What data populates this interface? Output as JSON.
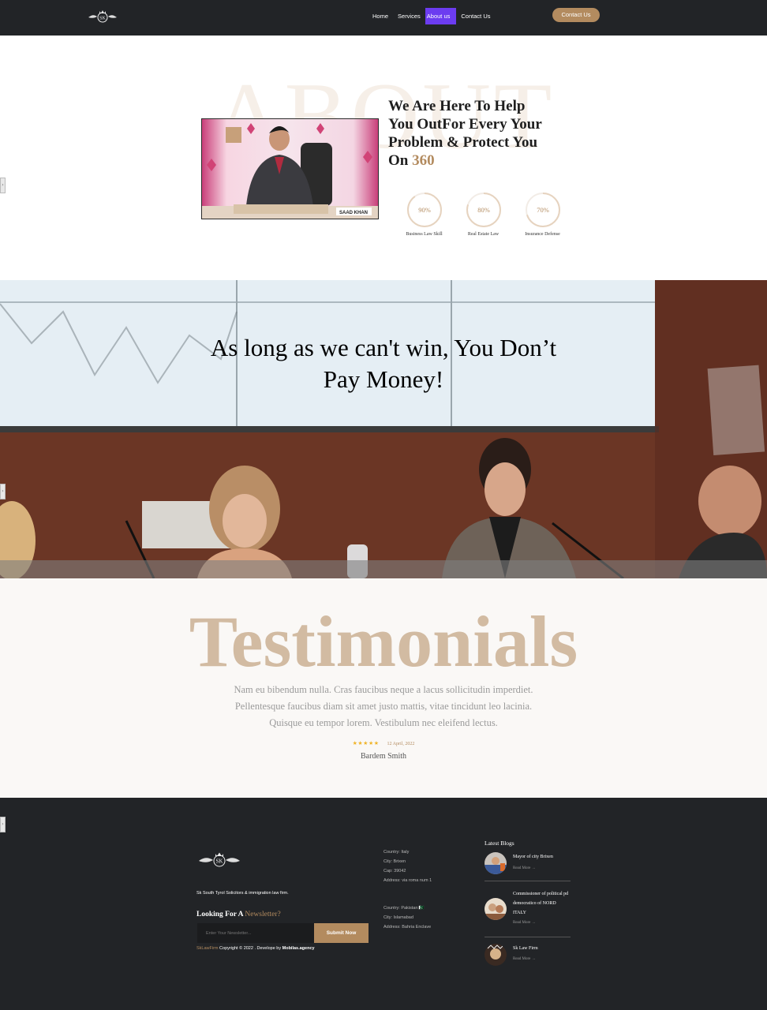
{
  "nav": {
    "links": [
      "Home",
      "Services",
      "About us",
      "Contact Us"
    ],
    "active_index": 2,
    "contact_button": "Contact Us",
    "logo_text": "SK"
  },
  "about": {
    "watermark": "ABOUT",
    "title_main": "We Are Here To Help You OutFor Every Your Problem & Protect You On ",
    "title_accent": "360",
    "photo_caption": "SAAD KHAN",
    "skills": [
      {
        "label": "Business Law Skill",
        "value_text": "90%",
        "value": 90
      },
      {
        "label": "Real Estate Law",
        "value_text": "80%",
        "value": 80
      },
      {
        "label": "Insurance Defense",
        "value_text": "70%",
        "value": 70
      }
    ]
  },
  "banner": {
    "heading_line1": "As long as we can't win, You Don’t",
    "heading_line2": "Pay Money!"
  },
  "testimonials": {
    "title": "Testimonials",
    "text_line1": "Nam eu bibendum nulla. Cras faucibus neque a lacus sollicitudin imperdiet.",
    "text_line2": "Pellentesque faucibus diam sit amet justo mattis, vitae tincidunt leo lacinia.",
    "text_line3": "Quisque eu tempor lorem. Vestibulum nec eleifend lectus.",
    "stars": "★★★★★",
    "rating": 5,
    "date": "12 April, 2022",
    "author": "Bardem Smith"
  },
  "footer": {
    "logo_text": "SK",
    "tagline": "Sk South Tyrol Solicitors & immigration law firm.",
    "newsletter_title": "Looking For A ",
    "newsletter_accent": "Newsletter?",
    "input_placeholder": "Enter Your Newsletter...",
    "submit_label": "Submit Now",
    "copy_brand": "SkLawFirm",
    "copy_text": " Copyright © 2022 . Develope by ",
    "copy_dev": "Mobilas.agency",
    "address_italy": [
      "Country: Italy",
      "City: Brixen",
      "Cap: 39042",
      "Address: via roma num 1"
    ],
    "address_pakistan": [
      "Country: Pakistan 🇵🇰",
      "City: Islamabad",
      "Address: Bahria Enclave"
    ],
    "blogs_title": "Latest Blogs",
    "blogs": [
      {
        "title": "Mayor of city Brixen",
        "more": "Read More →"
      },
      {
        "title": "Commissioner of political pd democratico of NORD ITALY",
        "more": "Read More →"
      },
      {
        "title": "Sk Law Firm",
        "more": "Read More →"
      }
    ]
  },
  "colors": {
    "accent": "#b38b5f",
    "nav_bg": "#222427",
    "active_nav": "#6c3cf0",
    "stars": "#f0b429"
  }
}
